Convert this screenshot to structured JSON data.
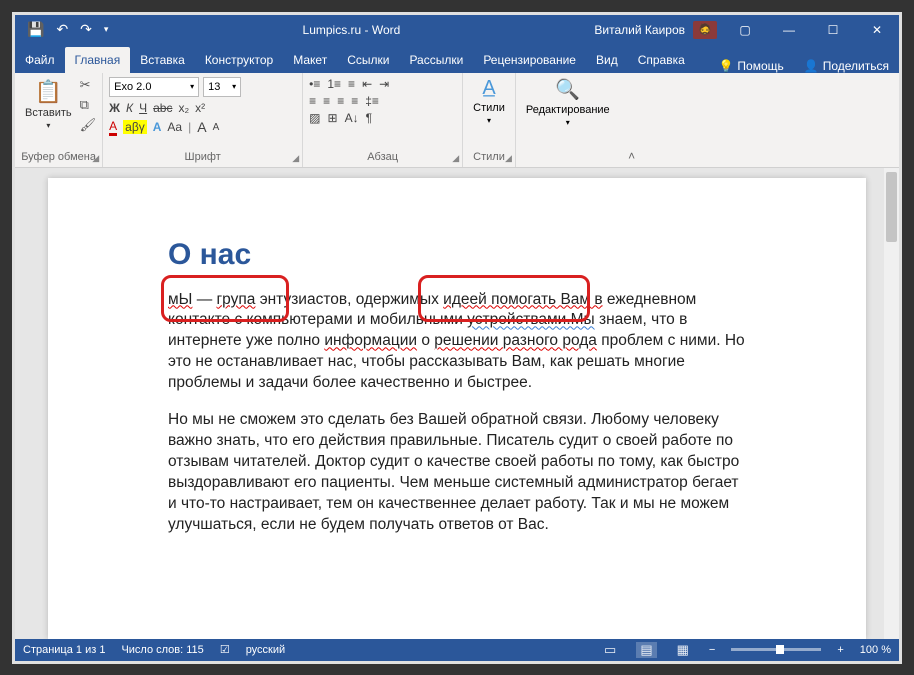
{
  "title": "Lumpics.ru - Word",
  "user": "Виталий Каиров",
  "tabs": {
    "file": "Файл",
    "home": "Главная",
    "insert": "Вставка",
    "design": "Конструктор",
    "layout": "Макет",
    "references": "Ссылки",
    "mailings": "Рассылки",
    "review": "Рецензирование",
    "view": "Вид",
    "help": "Справка",
    "tell": "Помощь",
    "share": "Поделиться"
  },
  "ribbon": {
    "clipboard": {
      "label": "Буфер обмена",
      "paste": "Вставить"
    },
    "font": {
      "label": "Шрифт",
      "name": "Exo 2.0",
      "size": "13",
      "bold": "Ж",
      "italic": "К",
      "underline": "Ч",
      "strike": "abc",
      "sub": "x₂",
      "sup": "x²",
      "color": "A",
      "hl": "aβγ",
      "fx": "A",
      "aa": "Aa",
      "grow": "A",
      "shrink": "A"
    },
    "para": {
      "label": "Абзац"
    },
    "styles": {
      "label": "Стили",
      "btn": "Стили"
    },
    "editing": {
      "label": "Редактирование"
    }
  },
  "doc": {
    "heading": "О нас",
    "p1_s1a": "мЫ",
    "p1_s1b": " — ",
    "p1_s1c": "група",
    "p1_s1d": " энтузиастов, одержимых ",
    "p1_s1e": "идеей помогать Вам в",
    "p1_s1f": " ежедневном контакте с компьютерами и мобильными ",
    "p1_s1g": "устройствами.Мы",
    "p1_s1h": " знаем, что в интернете уже полно ",
    "p1_s1i": "информации",
    "p1_s1j": " о ",
    "p1_s1k": "решении разного рода",
    "p1_s1l": " проблем с ними. Но это не останавливает нас, чтобы рассказывать Вам, как решать многие проблемы и задачи более качественно и быстрее.",
    "p2": "Но мы не сможем это сделать без Вашей обратной связи. Любому человеку важно знать, что его действия правильные. Писатель судит о своей работе по отзывам читателей. Доктор судит о качестве своей работы по тому, как быстро выздоравливают его пациенты. Чем меньше системный администратор бегает и что-то настраивает, тем он качественнее делает работу. Так и мы не можем улучшаться, если не будем получать ответов от Вас."
  },
  "status": {
    "page": "Страница 1 из 1",
    "words": "Число слов: 115",
    "lang": "русский",
    "zoom": "100 %"
  }
}
